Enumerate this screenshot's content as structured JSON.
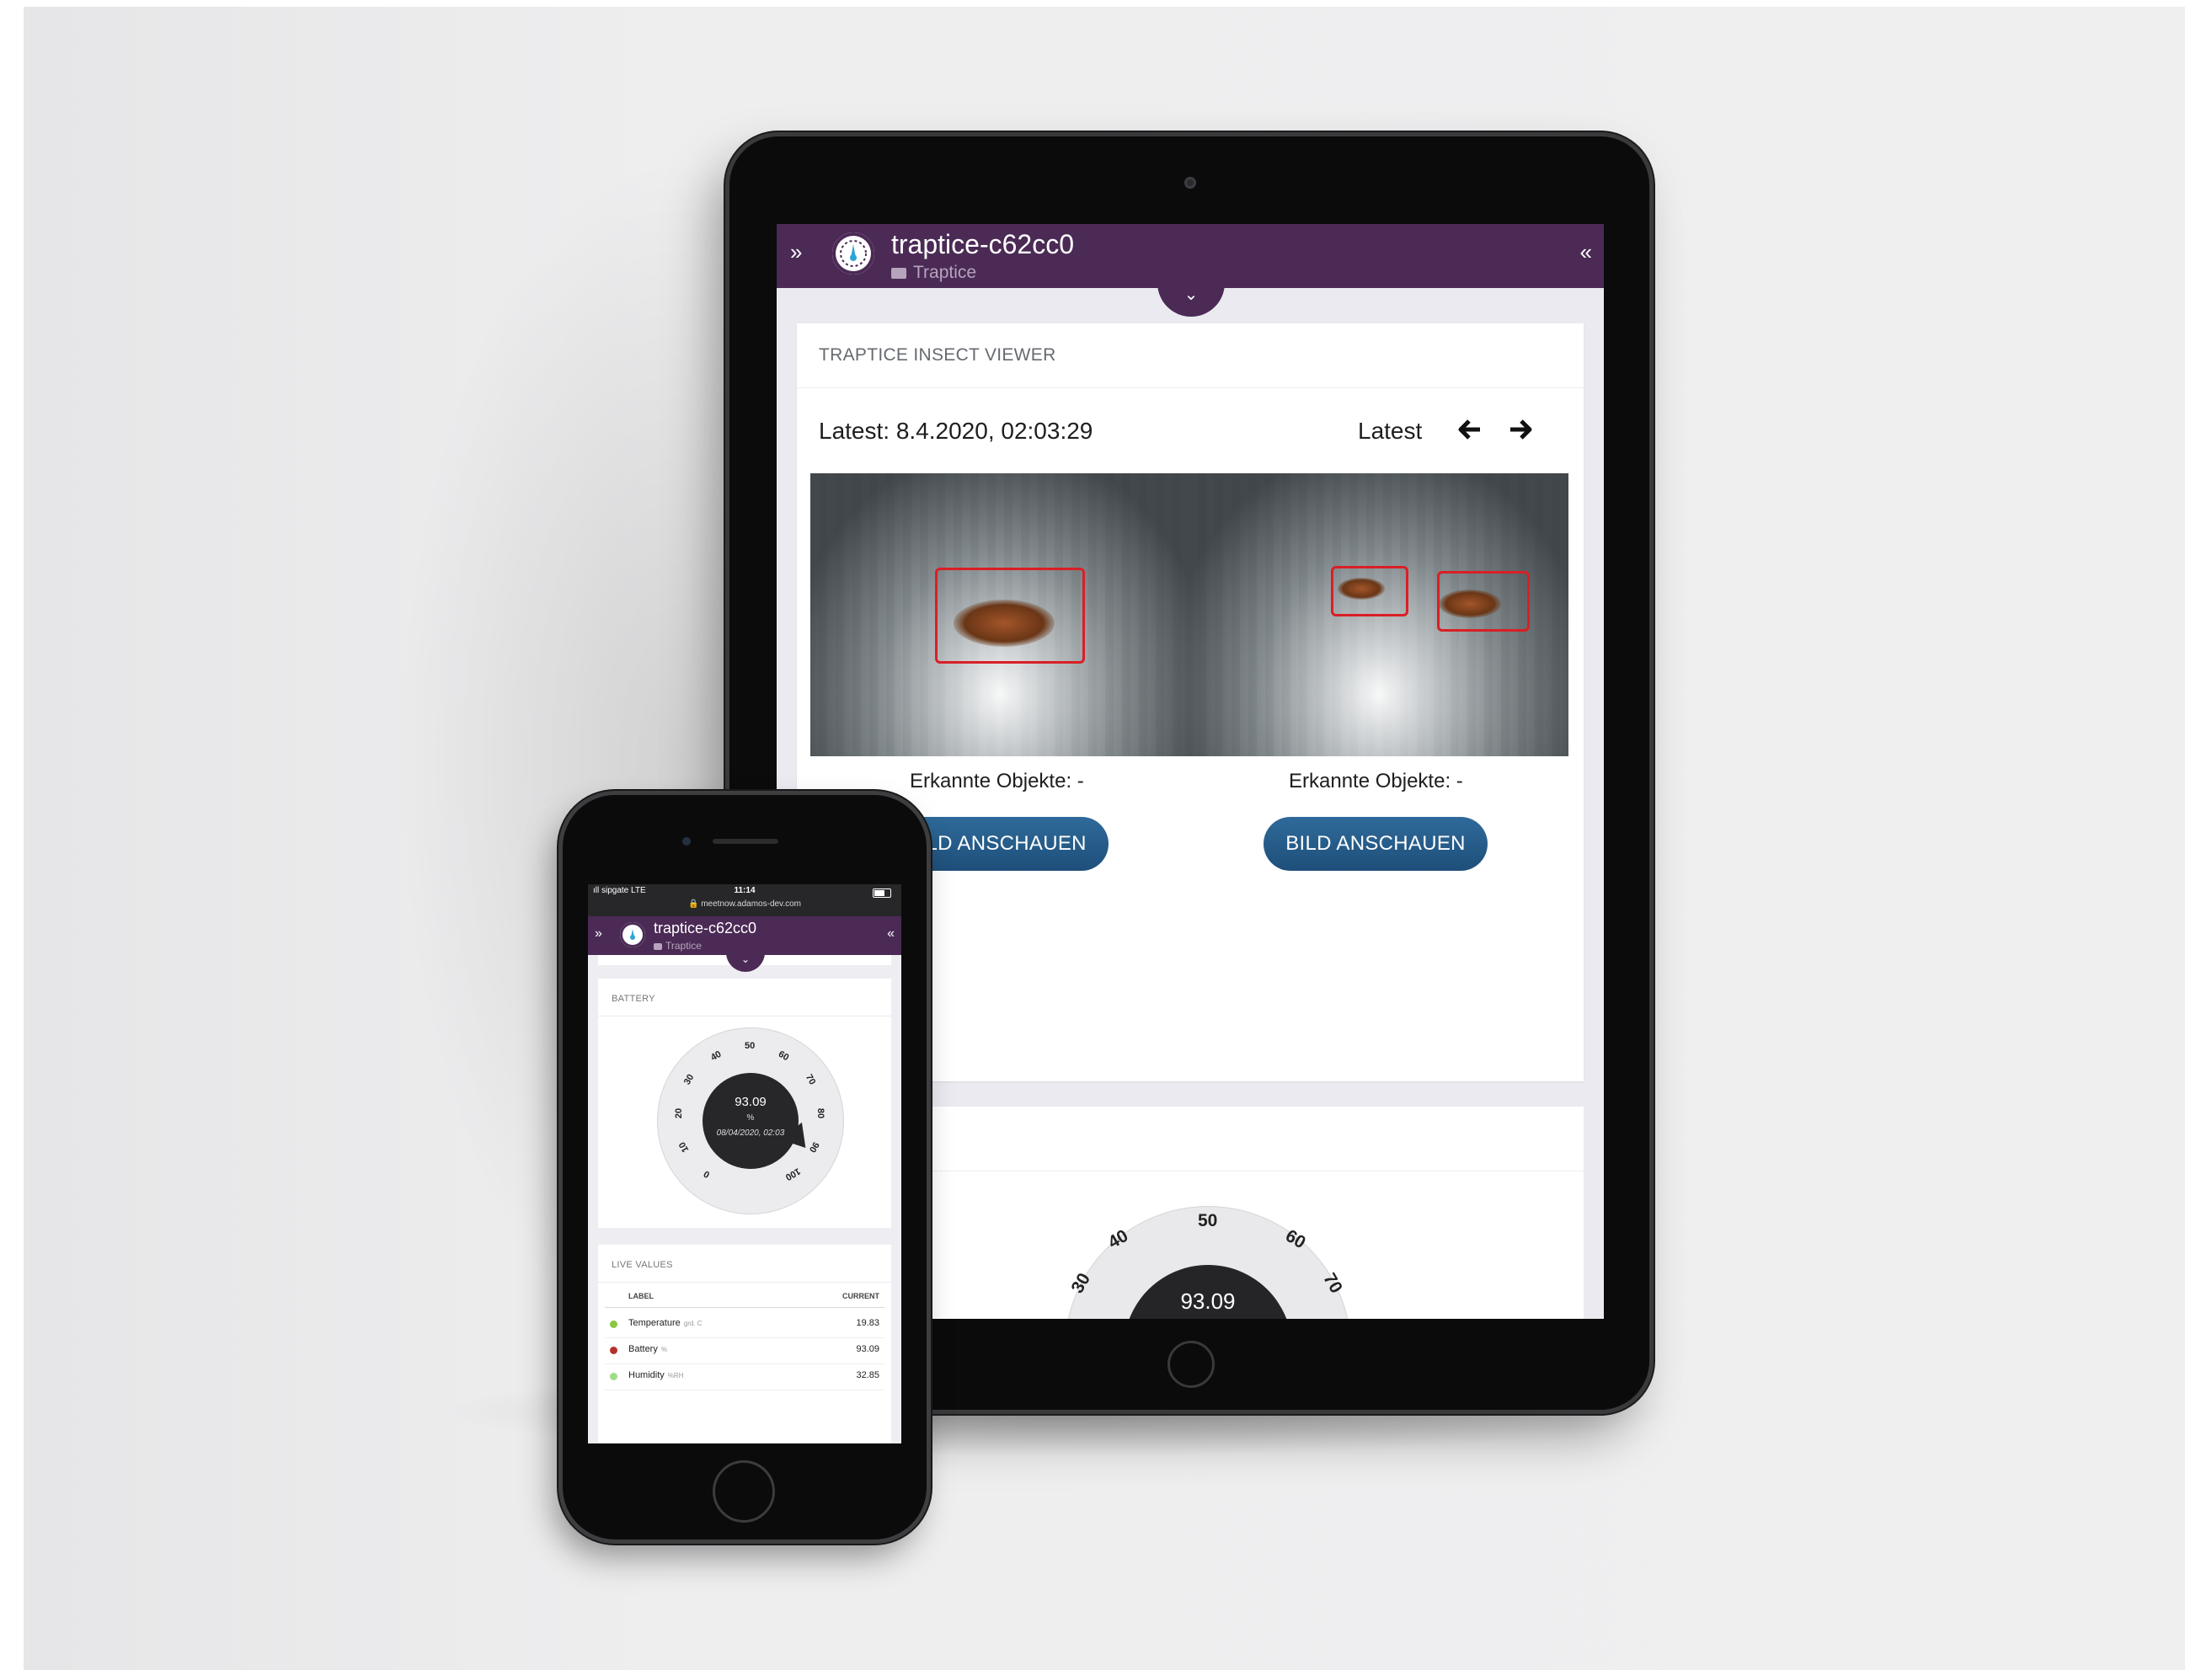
{
  "tablet": {
    "header": {
      "expand_icon": "»",
      "collapse_icon": "«",
      "device_name": "traptice-c62cc0",
      "group": "Traptice",
      "dropdown_icon": "⌄"
    },
    "viewer": {
      "title": "TRAPTICE INSECT VIEWER",
      "latest_timestamp": "Latest: 8.4.2020, 02:03:29",
      "latest_button": "Latest",
      "prev_icon": "🡐",
      "next_icon": "🡒",
      "images": [
        {
          "caption": "Erkannte Objekte: -",
          "button": "BILD ANSCHAUEN"
        },
        {
          "caption": "Erkannte Objekte: -",
          "button": "BILD ANSCHAUEN"
        }
      ]
    },
    "battery_gauge": {
      "value": "93.09",
      "ticks": [
        "30",
        "40",
        "50",
        "60",
        "70"
      ]
    },
    "colors": {
      "header": "#4b2a55",
      "button": "#2f6a9a",
      "box": "#d91f26"
    }
  },
  "phone": {
    "status_bar": {
      "carrier": "ıll sipgate  LTE",
      "time": "11:14",
      "url": "🔒 meetnow.adamos-dev.com"
    },
    "header": {
      "expand_icon": "»",
      "collapse_icon": "«",
      "device_name": "traptice-c62cc0",
      "group": "Traptice",
      "dropdown_icon": "⌄"
    },
    "battery": {
      "title": "BATTERY",
      "value": "93.09",
      "unit": "%",
      "date": "08/04/2020, 02:03",
      "ticks": [
        "0",
        "10",
        "20",
        "30",
        "40",
        "50",
        "60",
        "70",
        "80",
        "90",
        "100"
      ]
    },
    "live_values": {
      "title": "LIVE VALUES",
      "col_label": "LABEL",
      "col_current": "CURRENT",
      "rows": [
        {
          "label": "Temperature",
          "unit": "grd. C",
          "value": "19.83",
          "color": "#8dc63f"
        },
        {
          "label": "Battery",
          "unit": "%",
          "value": "93.09",
          "color": "#b5302a"
        },
        {
          "label": "Humidity",
          "unit": "%RH",
          "value": "32.85",
          "color": "#9fdc8a"
        }
      ]
    }
  }
}
